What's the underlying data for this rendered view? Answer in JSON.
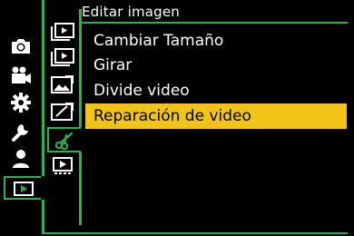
{
  "header": {
    "title": "Editar imagen"
  },
  "main_tabs": [
    {
      "name": "photo-icon"
    },
    {
      "name": "video-camera-icon"
    },
    {
      "name": "gear-icon"
    },
    {
      "name": "wrench-icon"
    },
    {
      "name": "person-icon"
    },
    {
      "name": "play-icon",
      "selected": true
    }
  ],
  "sub_tabs": [
    {
      "name": "playback-screen-icon"
    },
    {
      "name": "playback-screen-2-icon"
    },
    {
      "name": "image-edit-icon"
    },
    {
      "name": "image-edit-2-icon"
    },
    {
      "name": "scissors-icon"
    },
    {
      "name": "video-screen-icon"
    }
  ],
  "menu": {
    "items": [
      {
        "label": "Cambiar Tamaño"
      },
      {
        "label": "Girar"
      },
      {
        "label": "Divide video"
      },
      {
        "label": "Reparación de video",
        "selected": true
      }
    ]
  },
  "colors": {
    "accent": "#2bb24c",
    "highlight": "#f2c417"
  }
}
